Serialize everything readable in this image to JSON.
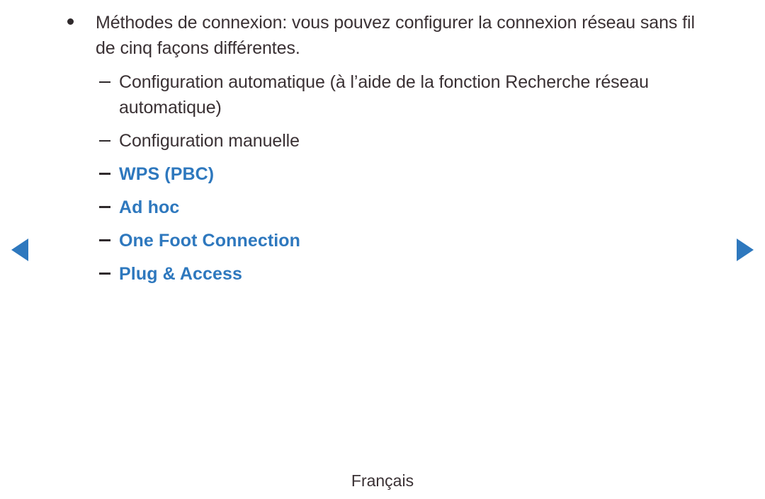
{
  "page": {
    "text_color": "#3a3134",
    "link_color": "#2e78be",
    "background": "#ffffff"
  },
  "content": {
    "bullet": {
      "marker": "bullet-dot",
      "text": "Méthodes de connexion: vous pouvez configurer la connexion réseau sans fil de cinq façons différentes."
    },
    "sub_items": [
      {
        "marker": "en-dash",
        "label": "Configuration automatique (à l’aide de la fonction Recherche réseau automatique)",
        "is_link": false
      },
      {
        "marker": "en-dash",
        "label": "Configuration manuelle",
        "is_link": false
      },
      {
        "marker": "en-dash",
        "label": "WPS (PBC)",
        "is_link": true
      },
      {
        "marker": "en-dash",
        "label": "Ad hoc",
        "is_link": true
      },
      {
        "marker": "en-dash",
        "label": "One Foot Connection",
        "is_link": true
      },
      {
        "marker": "en-dash",
        "label": "Plug & Access",
        "is_link": true
      }
    ]
  },
  "navigation": {
    "prev": {
      "icon": "triangle-left-icon",
      "label": ""
    },
    "next": {
      "icon": "triangle-right-icon",
      "label": ""
    }
  },
  "footer": {
    "language": "Français"
  }
}
